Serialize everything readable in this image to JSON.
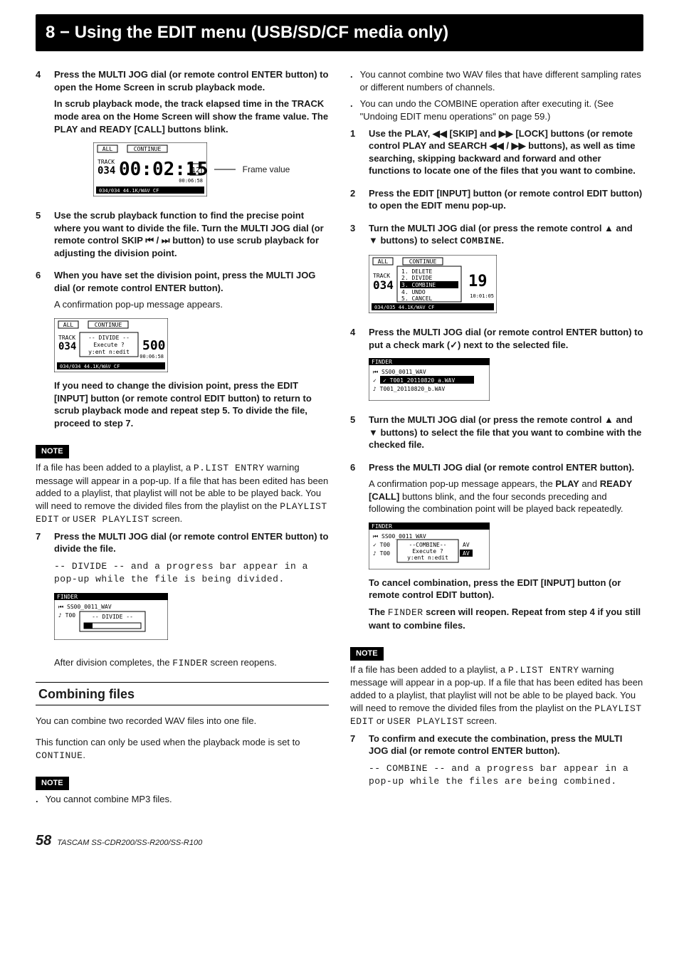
{
  "header": "8 − Using the EDIT menu (USB/SD/CF media only)",
  "left": {
    "step4": {
      "p1": "Press the MULTI JOG dial (or remote control ENTER button) to open the Home Screen in scrub playback mode.",
      "p2": "In scrub playback mode, the track elapsed time in the TRACK mode area on the Home Screen will show the frame value. The PLAY and READY [CALL] buttons blink."
    },
    "frame_label": "Frame value",
    "step5": "Use the scrub playback function to find the precise point where you want to divide the file. Turn the MULTI JOG dial (or remote control SKIP ⏮ / ⏭ button) to use scrub playback for adjusting the division point.",
    "step6": {
      "p1": "When you have set the division point, press the MULTI JOG dial (or remote control ENTER button).",
      "p2": "A confirmation pop-up message appears."
    },
    "step6b": "If you need to change the division point, press the EDIT [INPUT] button (or remote control EDIT button) to return to scrub playback mode and repeat step 5. To divide the file, proceed to step 7.",
    "note1_p1": "If a file has been added to a playlist, a ",
    "note1_m1": "P.LIST ENTRY",
    "note1_p2": " warning message will appear in a pop-up. If a file that has been edited has been added to a playlist, that playlist will not be able to be played back. You will need to remove the divided files from the playlist on the ",
    "note1_m2": "PLAYLIST EDIT",
    "note1_p3": " or ",
    "note1_m3": "USER PLAYLIST",
    "note1_p4": " screen.",
    "step7": {
      "p1": "Press the MULTI JOG dial (or remote control ENTER button) to divide the file.",
      "p2a": "-- ",
      "p2m": "DIVIDE",
      "p2b": " -- and a progress bar appear in a pop-up while the file is being divided."
    },
    "after_div_a": "After division completes, the ",
    "after_div_m": "FINDER",
    "after_div_b": " screen reopens.",
    "combine_head": "Combining files",
    "combine_p1": "You can combine two recorded WAV files into one file.",
    "combine_p2a": "This function can only be used when the playback mode is set to ",
    "combine_p2m": "CONTINUE",
    "combine_p2b": ".",
    "note2_dot1": "You cannot combine MP3 files."
  },
  "right": {
    "dot1": "You cannot combine two WAV files that have different sampling rates or different numbers of channels.",
    "dot2": "You can undo the COMBINE operation after executing it. (See \"Undoing EDIT menu operations\" on page 59.)",
    "step1": "Use the PLAY, ◀◀ [SKIP] and ▶▶ [LOCK] buttons (or remote control PLAY and SEARCH ◀◀ / ▶▶ buttons), as well as time searching, skipping backward and forward and other functions to locate one of the files that you want to combine.",
    "step2": "Press the EDIT [INPUT] button (or remote control EDIT button) to open the EDIT menu pop-up.",
    "step3a": "Turn the MULTI JOG dial (or press the remote control ▲ and ▼ buttons) to select ",
    "step3m": "COMBINE",
    "step3b": ".",
    "step4": "Press the MULTI JOG dial (or remote control ENTER button) to put a check mark (✓) next to the selected file.",
    "step5": "Turn the MULTI JOG dial (or press the remote control ▲ and ▼ buttons) to select the file that you want to combine with the checked file.",
    "step6": {
      "p1": "Press the MULTI JOG dial (or remote control ENTER button).",
      "p2a": "A confirmation pop-up message appears, the ",
      "p2b": "PLAY",
      "p2c": " and ",
      "p2d": "READY [CALL]",
      "p2e": " buttons blink, and the four seconds preceding and following the combination point will be played back repeatedly."
    },
    "cancel": "To cancel combination, press the EDIT [INPUT] button (or remote control EDIT button).",
    "reopen_a": "The ",
    "reopen_m": "FINDER",
    "reopen_b": " screen will reopen. Repeat from step 4 if you still want to combine files.",
    "note_p1": "If a file has been added to a playlist, a ",
    "note_m1": "P.LIST ENTRY",
    "note_p2": " warning message will appear in a pop-up. If a file that has been edited has been added to a playlist, that playlist will not be able to be played back. You will need to remove the divided files from the playlist on the ",
    "note_m2": "PLAYLIST EDIT",
    "note_p3": " or ",
    "note_m3": "USER PLAYLIST",
    "note_p4": " screen.",
    "step7": {
      "p1": "To confirm and execute the combination, press the MULTI JOG dial (or remote control ENTER button).",
      "p2a": "-- ",
      "p2m": "COMBINE",
      "p2b": " -- and a progress bar appear in a pop-up while the files are being combined."
    }
  },
  "note_label": "NOTE",
  "footer": {
    "page": "58",
    "model": "TASCAM SS-CDR200/SS-R200/SS-R100"
  },
  "lcd": {
    "scrub": {
      "all": "ALL",
      "cont": "CONTINUE",
      "track": "TRACK",
      "num": "034",
      "time": "00:02:15",
      "sub": "12",
      "dur": "00:06:58",
      "foot": "034/034  44.1K/WAV            CF"
    },
    "divide_confirm": {
      "all": "ALL",
      "cont": "CONTINUE",
      "track": "TRACK",
      "num": "034",
      "l1": "-- DIVIDE --",
      "l2": "Execute ?",
      "l3": "y:ent n:edit",
      "big": "500",
      "dur": "00:06:58",
      "foot": "034/034  44.1K/WAV            CF"
    },
    "divide_progress": {
      "title": "FINDER",
      "row1": "⏮ SS00_0011_WAV",
      "row2": "♪ T00",
      "bar": "-- DIVIDE --"
    },
    "edit_menu": {
      "all": "ALL",
      "cont": "CONTINUE",
      "track": "TRACK",
      "num": "034",
      "items": [
        "1. DELETE",
        "2. DIVIDE",
        "3. COMBINE",
        "4. UNDO",
        "5. CANCEL"
      ],
      "big": "19",
      "dur": "10:01:05",
      "foot": "034/035  44.1K/WAV            CF"
    },
    "combine_check": {
      "title": "FINDER",
      "row1": "⏮ SS00_0011_WAV",
      "row2": "✓ T001_20110820_a.WAV",
      "row3": "♪ T001_20110820_b.WAV"
    },
    "combine_confirm": {
      "title": "FINDER",
      "row1": "⏮ SS00_0011_WAV",
      "r2a": "✓ T00",
      "r3a": "♪ T00",
      "l1": "--COMBINE--",
      "l2": "Execute ?",
      "l3": "y:ent n:edit",
      "suf": "AV"
    }
  }
}
